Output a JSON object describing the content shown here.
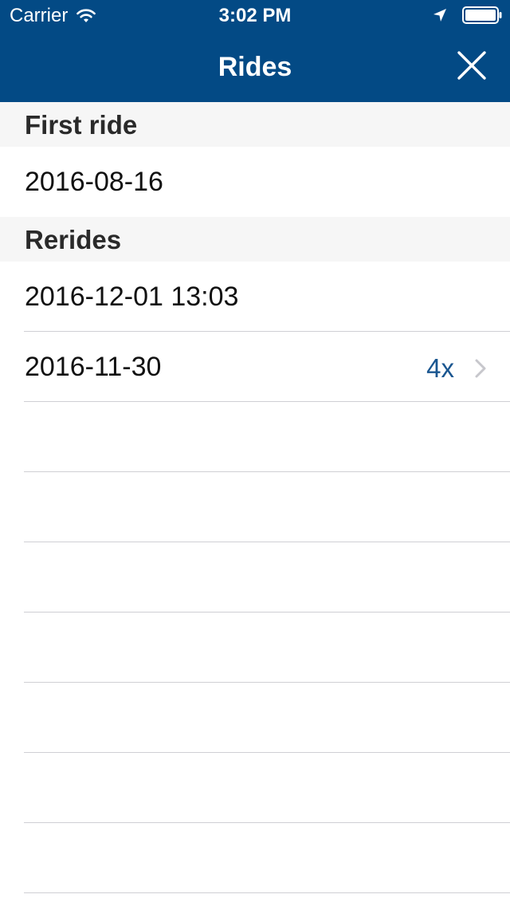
{
  "status_bar": {
    "carrier": "Carrier",
    "time": "3:02 PM",
    "icons": [
      "wifi-icon",
      "location-arrow-icon",
      "battery-icon"
    ]
  },
  "nav": {
    "title": "Rides",
    "close_icon": "close-icon"
  },
  "sections": {
    "first_ride": {
      "header": "First ride",
      "date": "2016-08-16"
    },
    "rerides": {
      "header": "Rerides",
      "rows": [
        {
          "label": "2016-12-01 13:03"
        },
        {
          "label": "2016-11-30",
          "count": "4x",
          "has_disclosure": true
        }
      ]
    }
  },
  "colors": {
    "nav_background": "#034A85",
    "section_header_background": "#F6F6F6",
    "accent_text": "#1A5690",
    "separator": "#CFCFD4",
    "chevron": "#C7C7CC"
  }
}
